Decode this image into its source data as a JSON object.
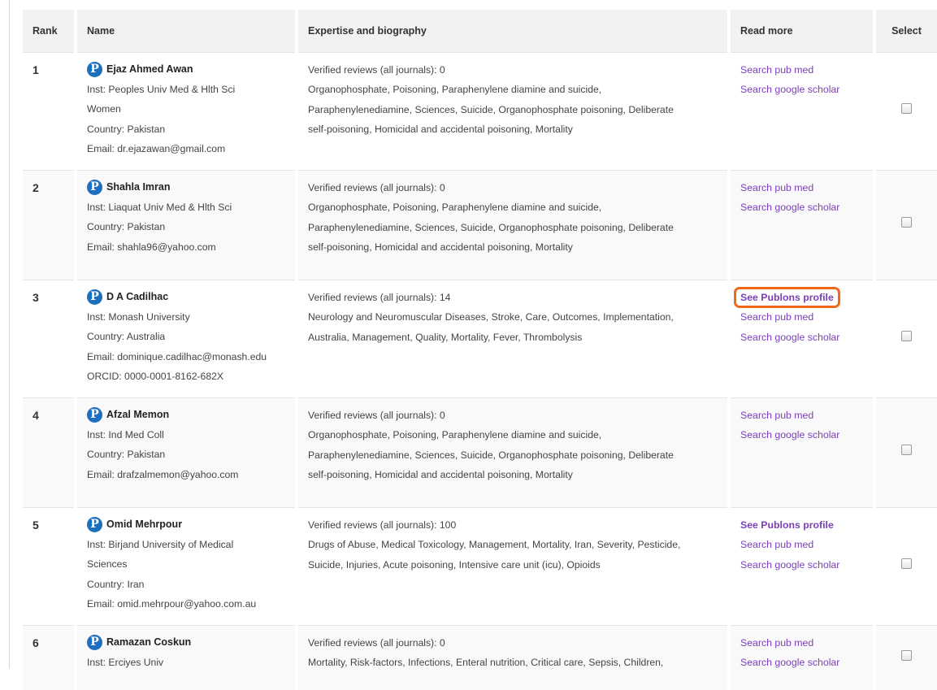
{
  "table": {
    "headers": {
      "rank": "Rank",
      "name": "Name",
      "expertise": "Expertise and biography",
      "read_more": "Read more",
      "select": "Select"
    },
    "rows": [
      {
        "rank": "1",
        "name": "Ejaz Ahmed Awan",
        "details": [
          "Inst: Peoples Univ Med & Hlth Sci",
          "Women",
          "Country: Pakistan",
          "Email: dr.ejazawan@gmail.com"
        ],
        "expertise": [
          "Verified reviews (all journals): 0",
          "Organophosphate, Poisoning, Paraphenylene diamine and suicide,",
          "Paraphenylenediamine, Sciences, Suicide, Organophosphate poisoning, Deliberate",
          "self-poisoning, Homicidal and accidental poisoning, Mortality"
        ],
        "links": [
          "Search pub med",
          "Search google scholar"
        ],
        "publons": "",
        "selected": false
      },
      {
        "rank": "2",
        "name": "Shahla Imran",
        "details": [
          "Inst: Liaquat Univ Med & Hlth Sci",
          "Country: Pakistan",
          "Email: shahla96@yahoo.com"
        ],
        "expertise": [
          "Verified reviews (all journals): 0",
          "Organophosphate, Poisoning, Paraphenylene diamine and suicide,",
          "Paraphenylenediamine, Sciences, Suicide, Organophosphate poisoning, Deliberate",
          "self-poisoning, Homicidal and accidental poisoning, Mortality"
        ],
        "links": [
          "Search pub med",
          "Search google scholar"
        ],
        "publons": "",
        "selected": false
      },
      {
        "rank": "3",
        "name": "D A Cadilhac",
        "details": [
          "Inst: Monash University",
          "Country: Australia",
          "Email: dominique.cadilhac@monash.edu",
          "ORCID: 0000-0001-8162-682X"
        ],
        "expertise": [
          "Verified reviews (all journals): 14",
          "Neurology and Neuromuscular Diseases, Stroke, Care, Outcomes, Implementation,",
          "Australia, Management, Quality, Mortality, Fever, Thrombolysis"
        ],
        "links": [
          "Search pub med",
          "Search google scholar"
        ],
        "publons": "See Publons profile",
        "highlight": true,
        "selected": false
      },
      {
        "rank": "4",
        "name": "Afzal Memon",
        "details": [
          "Inst: Ind Med Coll",
          "Country: Pakistan",
          "Email: drafzalmemon@yahoo.com"
        ],
        "expertise": [
          "Verified reviews (all journals): 0",
          "Organophosphate, Poisoning, Paraphenylene diamine and suicide,",
          "Paraphenylenediamine, Sciences, Suicide, Organophosphate poisoning, Deliberate",
          "self-poisoning, Homicidal and accidental poisoning, Mortality"
        ],
        "links": [
          "Search pub med",
          "Search google scholar"
        ],
        "publons": "",
        "selected": false
      },
      {
        "rank": "5",
        "name": "Omid Mehrpour",
        "details": [
          "Inst: Birjand University of Medical",
          "Sciences",
          "Country: Iran",
          "Email: omid.mehrpour@yahoo.com.au"
        ],
        "expertise": [
          "Verified reviews (all journals): 100",
          "Drugs of Abuse, Medical Toxicology, Management, Mortality, Iran, Severity, Pesticide,",
          "Suicide, Injuries, Acute poisoning, Intensive care unit (icu), Opioids"
        ],
        "links": [
          "Search pub med",
          "Search google scholar"
        ],
        "publons": "See Publons profile",
        "highlight": false,
        "selected": false
      },
      {
        "rank": "6",
        "name": "Ramazan Coskun",
        "details": [
          "Inst: Erciyes Univ"
        ],
        "expertise": [
          "Verified reviews (all journals): 0",
          "Mortality, Risk-factors, Infections, Enteral nutrition, Critical care, Sepsis, Children,"
        ],
        "links": [
          "Search pub med",
          "Search google scholar"
        ],
        "publons": "",
        "selected": false
      }
    ]
  },
  "colors": {
    "link": "#7b3fb6",
    "highlight_border": "#f06a1e",
    "publons_icon": "#1f6fbf",
    "header_bg": "#f2f2f2"
  },
  "icons": {
    "publons": "publons-p-icon"
  }
}
